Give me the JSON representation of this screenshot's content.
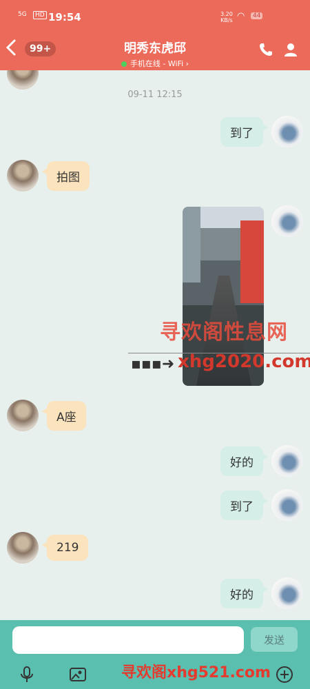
{
  "status": {
    "time": "19:54",
    "signal": "5G",
    "hd": "HD",
    "net_speed": "3.20",
    "net_unit": "KB/s",
    "battery": "44"
  },
  "header": {
    "unread_badge": "99+",
    "title": "明秀东虎邱",
    "presence": "手机在线 - WiFi ›"
  },
  "chat": {
    "timestamp": "09-11 12:15",
    "messages": [
      {
        "side": "right",
        "text": "到了"
      },
      {
        "side": "left",
        "text": "拍图"
      },
      {
        "side": "right",
        "text": "[image]"
      },
      {
        "side": "left",
        "text": "A座"
      },
      {
        "side": "right",
        "text": "好的"
      },
      {
        "side": "right",
        "text": "到了"
      },
      {
        "side": "left",
        "text": "219"
      },
      {
        "side": "right",
        "text": "好的"
      }
    ]
  },
  "watermark": {
    "cn": "寻欢阁性息网",
    "url": "xhg2020.com",
    "bottom": "寻欢阁xhg521.com"
  },
  "composer": {
    "placeholder": "",
    "send_label": "发送"
  },
  "colors": {
    "header": "#ec6a59",
    "left_bubble": "#fbe3bd",
    "right_bubble": "#d5efe8",
    "bottom_bar": "#5bbfb0"
  }
}
